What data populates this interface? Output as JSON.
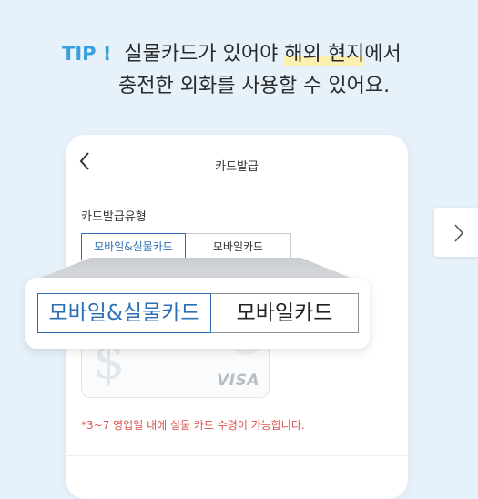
{
  "tip": {
    "label": "TIP !",
    "line1_prefix": "실물카드가 있어야 ",
    "line1_highlight": "해외 현지",
    "line1_suffix": "에서",
    "line2": "충전한 외화를 사용할 수 있어요."
  },
  "phone": {
    "title": "카드발급",
    "field_label": "카드발급유형",
    "options": [
      "모바일&실물카드",
      "모바일카드"
    ],
    "selected": "모바일&실물카드",
    "card_brand": "VISA",
    "notice": "*3~7 영업일 내에 실물 카드 수령이 가능합니다."
  },
  "magnifier": {
    "options": [
      "모바일&실물카드",
      "모바일카드"
    ]
  },
  "colors": {
    "background": "#e6f1fa",
    "tip_accent": "#3aa0dc",
    "selected_blue": "#2f6fb5",
    "notice_red": "#d9534f",
    "highlight": "#fbf0b0"
  },
  "icons": {
    "back": "chevron-left-icon",
    "next": "chevron-right-icon"
  }
}
